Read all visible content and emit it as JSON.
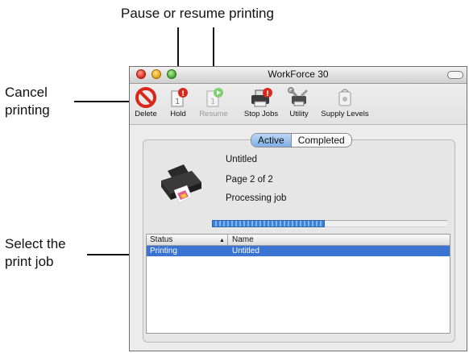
{
  "callouts": {
    "pause_resume": "Pause or resume printing",
    "cancel_line1": "Cancel",
    "cancel_line2": "printing",
    "select_line1": "Select the",
    "select_line2": "print job"
  },
  "window": {
    "title": "WorkForce 30"
  },
  "toolbar": {
    "delete": "Delete",
    "hold": "Hold",
    "resume": "Resume",
    "stop_jobs": "Stop Jobs",
    "utility": "Utility",
    "supply_levels": "Supply Levels"
  },
  "tabs": {
    "active": "Active",
    "completed": "Completed"
  },
  "job": {
    "name": "Untitled",
    "page": "Page 2 of 2",
    "status": "Processing job",
    "progress": 0.48
  },
  "table": {
    "headers": {
      "status": "Status",
      "name": "Name"
    },
    "rows": [
      {
        "status": "Printing",
        "name": "Untitled"
      }
    ]
  },
  "colors": {
    "selection": "#3a74d2",
    "delete_red": "#d8281b",
    "resume_green": "#3fa62a"
  }
}
